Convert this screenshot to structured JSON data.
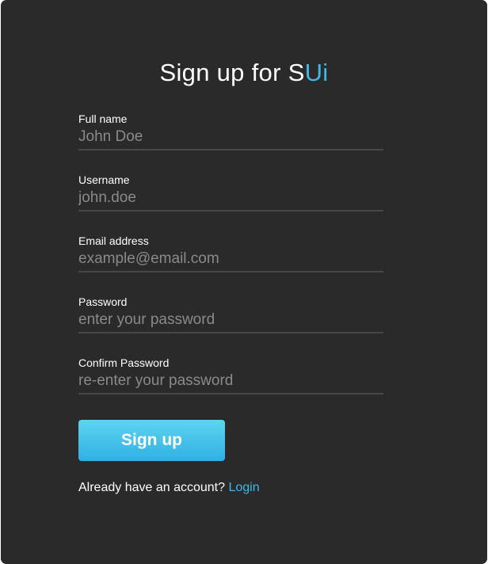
{
  "title": {
    "prefix": "Sign up for ",
    "brand_s": "S",
    "brand_ui": "Ui"
  },
  "form": {
    "fields": [
      {
        "label": "Full name",
        "placeholder": "John Doe",
        "value": ""
      },
      {
        "label": "Username",
        "placeholder": "john.doe",
        "value": ""
      },
      {
        "label": "Email address",
        "placeholder": "example@email.com",
        "value": ""
      },
      {
        "label": "Password",
        "placeholder": "enter your password",
        "value": ""
      },
      {
        "label": "Confirm Password",
        "placeholder": "re-enter your password",
        "value": ""
      }
    ],
    "submit_label": "Sign up"
  },
  "footer": {
    "text": "Already have an account? ",
    "link_label": "Login"
  },
  "colors": {
    "background": "#2a2a2a",
    "accent": "#3fb8e6",
    "button_gradient_top": "#5ed4f0",
    "button_gradient_bottom": "#2fb0e4"
  }
}
